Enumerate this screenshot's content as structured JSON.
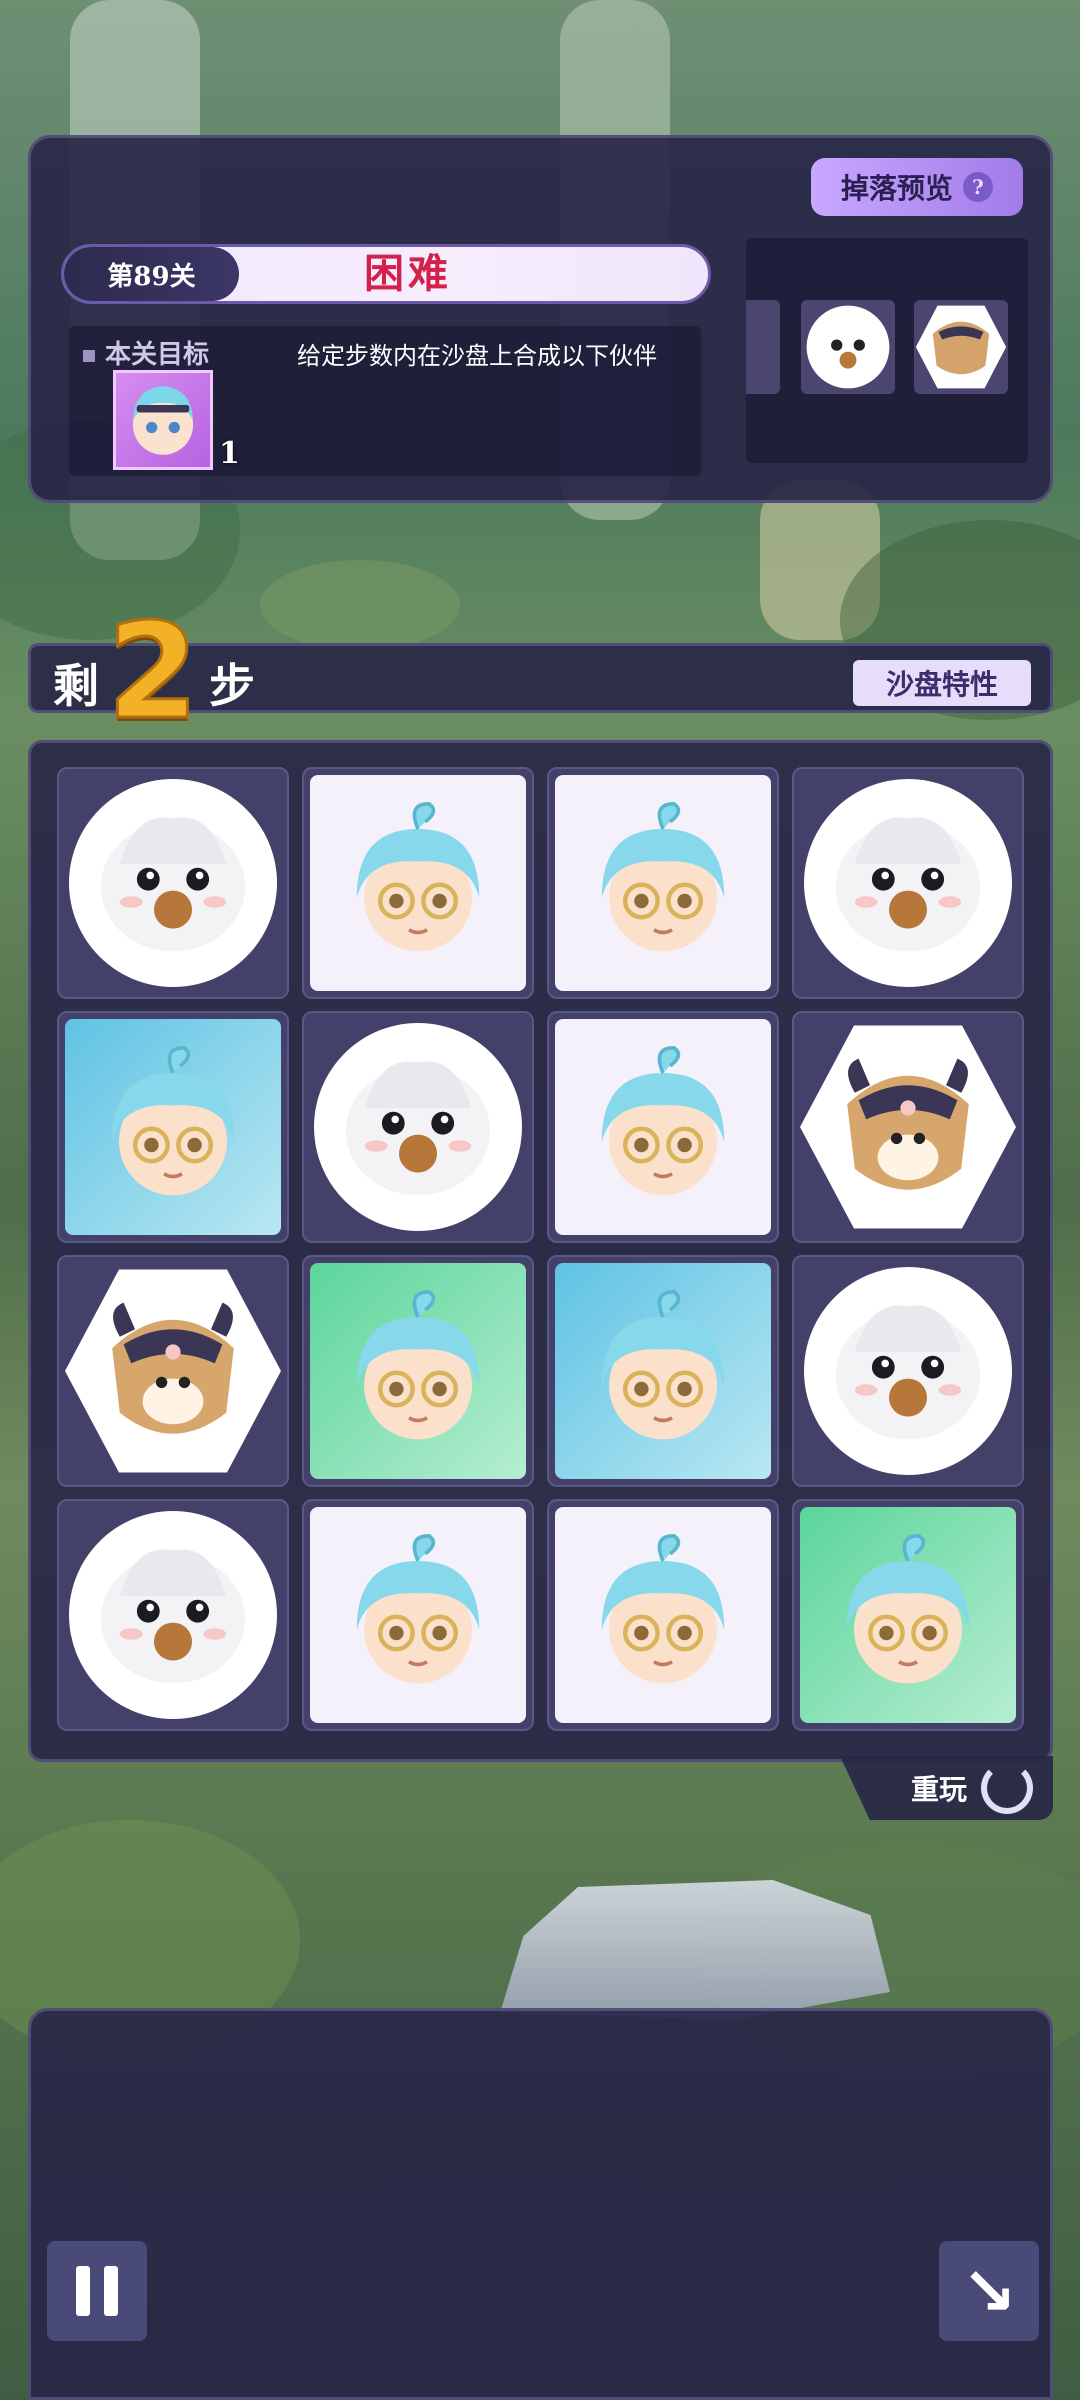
{
  "level": {
    "label": "第89关",
    "difficulty": "困难",
    "goal_title": "本关目标",
    "goal_description": "给定步数内在沙盘上合成以下伙伴",
    "goal_item_count": "1",
    "drop_preview_label": "掉落预览",
    "drop_preview_help": "?"
  },
  "steps": {
    "prefix": "剩",
    "remaining": "2",
    "suffix": "步",
    "trait_button": "沙盘特性"
  },
  "board": {
    "rows": [
      [
        "white-bird",
        "boy-tier1",
        "boy-tier1",
        "white-bird"
      ],
      [
        "boy-tier3-blue",
        "white-bird",
        "boy-tier1",
        "horned-creature"
      ],
      [
        "horned-creature",
        "boy-tier2-green",
        "boy-tier3-blue",
        "white-bird"
      ],
      [
        "white-bird",
        "boy-tier1",
        "boy-tier1",
        "boy-tier2-green"
      ]
    ]
  },
  "replay_label": "重玩",
  "colors": {
    "panel": "#28264A",
    "difficulty": "#D3204C",
    "steps_number": "#F3B128",
    "drop_button": "#A27BE8"
  }
}
